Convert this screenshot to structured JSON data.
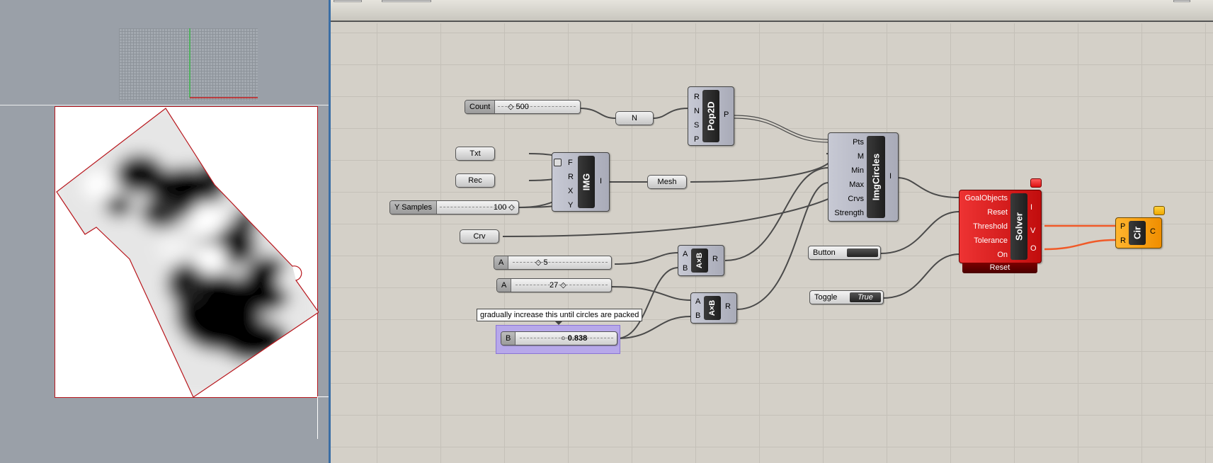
{
  "canvas": {
    "count_slider": {
      "label": "Count",
      "value": "500"
    },
    "n_node": {
      "label": "N"
    },
    "pop2d": {
      "title": "Pop2D",
      "inputs": [
        "R",
        "N",
        "S",
        "P"
      ],
      "outputs": [
        "P"
      ]
    },
    "txt_param": {
      "label": "Txt"
    },
    "rec_param": {
      "label": "Rec"
    },
    "y_samples": {
      "label": "Y Samples",
      "value": "100"
    },
    "img": {
      "title": "IMG",
      "inputs": [
        "F",
        "R",
        "X",
        "Y"
      ],
      "outputs": [
        "I"
      ]
    },
    "mesh_param": {
      "label": "Mesh"
    },
    "crv_param": {
      "label": "Crv"
    },
    "imgcircles": {
      "title": "ImgCircles",
      "inputs": [
        "Pts",
        "M",
        "Min",
        "Max",
        "Crvs",
        "Strength"
      ],
      "outputs": [
        "I"
      ]
    },
    "slider_a1": {
      "label": "A",
      "value": "5"
    },
    "slider_a2": {
      "label": "A",
      "value": "27"
    },
    "slider_b": {
      "label": "B",
      "value": "0.838"
    },
    "tooltip": "gradually increase this until circles are packed",
    "mul1": {
      "title": "A×B",
      "inputs": [
        "A",
        "B"
      ],
      "outputs": [
        "R"
      ]
    },
    "mul2": {
      "title": "A×B",
      "inputs": [
        "A",
        "B"
      ],
      "outputs": [
        "R"
      ]
    },
    "button": {
      "label": "Button"
    },
    "toggle": {
      "label": "Toggle",
      "value": "True"
    },
    "solver": {
      "title": "Solver",
      "inputs": [
        "GoalObjects",
        "Reset",
        "Threshold",
        "Tolerance",
        "On"
      ],
      "outputs": [
        "I",
        "V",
        "O"
      ],
      "footer": "Reset"
    },
    "cir": {
      "title": "Cir",
      "inputs": [
        "P",
        "R"
      ],
      "outputs": [
        "C"
      ]
    }
  },
  "colors": {
    "canvas": "#d4d0c8",
    "solver": "#d41515",
    "cir": "#f6a11a",
    "wire_active": "#f05a28",
    "selection": "#b7a8ea"
  }
}
